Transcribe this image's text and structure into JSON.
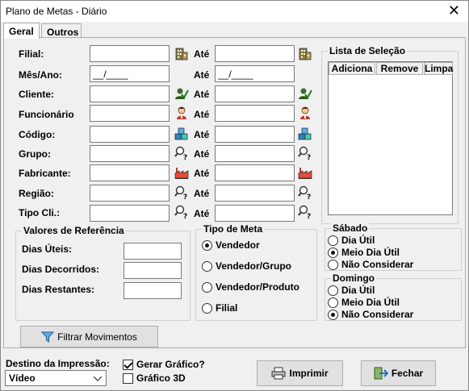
{
  "window": {
    "title": "Plano de Metas - Diário",
    "close_glyph": "✕"
  },
  "tabs": [
    {
      "label": "Geral"
    },
    {
      "label": "Outros"
    }
  ],
  "ate_label": "Até",
  "filters": [
    {
      "label": "Filial:",
      "from": "",
      "to": "",
      "icon": "building-icon"
    },
    {
      "label": "Mês/Ano:",
      "from": "__/____",
      "to": "__/____",
      "icon": ""
    },
    {
      "label": "Cliente:",
      "from": "",
      "to": "",
      "icon": "user-check-icon"
    },
    {
      "label": "Funcionário",
      "from": "",
      "to": "",
      "icon": "person-icon"
    },
    {
      "label": "Código:",
      "from": "",
      "to": "",
      "icon": "boxes-icon"
    },
    {
      "label": "Grupo:",
      "from": "",
      "to": "",
      "icon": "magnifier-question-icon"
    },
    {
      "label": "Fabricante:",
      "from": "",
      "to": "",
      "icon": "factory-icon"
    },
    {
      "label": "Região:",
      "from": "",
      "to": "",
      "icon": "magnifier-question-icon"
    },
    {
      "label": "Tipo Cli.:",
      "from": "",
      "to": "",
      "icon": "magnifier-question-icon"
    }
  ],
  "selection_list": {
    "title": "Lista de Seleção",
    "buttons": {
      "add": "Adiciona",
      "remove": "Remove",
      "clear": "Limpa"
    }
  },
  "reference_values": {
    "title": "Valores de Referência",
    "items": [
      {
        "label": "Dias Úteis:",
        "value": ""
      },
      {
        "label": "Dias Decorridos:",
        "value": ""
      },
      {
        "label": "Dias Restantes:",
        "value": ""
      }
    ]
  },
  "goal_type": {
    "title": "Tipo de Meta",
    "options": [
      "Vendedor",
      "Vendedor/Grupo",
      "Vendedor/Produto",
      "Filial"
    ],
    "selected": "Vendedor"
  },
  "saturday": {
    "title": "Sábado",
    "options": [
      "Dia Útil",
      "Meio Dia Útil",
      "Não Considerar"
    ],
    "selected": "Meio Dia Útil"
  },
  "sunday": {
    "title": "Domingo",
    "options": [
      "Dia Útil",
      "Meio Dia Útil",
      "Não Considerar"
    ],
    "selected": "Não Considerar"
  },
  "filter_button": {
    "label": "Filtrar Movimentos",
    "icon": "funnel-icon"
  },
  "print_destination": {
    "label": "Destino da Impressão:",
    "value": "Vídeo"
  },
  "checkboxes": [
    {
      "label": "Gerar Gráfico?",
      "checked": true
    },
    {
      "label": "Gráfico 3D",
      "checked": false
    }
  ],
  "actions": {
    "print": {
      "label": "Imprimir",
      "icon": "printer-icon"
    },
    "close": {
      "label": "Fechar",
      "icon": "exit-icon"
    }
  },
  "colors": {
    "window_bg": "#f0f0f0",
    "field_bg": "#ffffff",
    "accent_blue": "#1f6fd0"
  }
}
